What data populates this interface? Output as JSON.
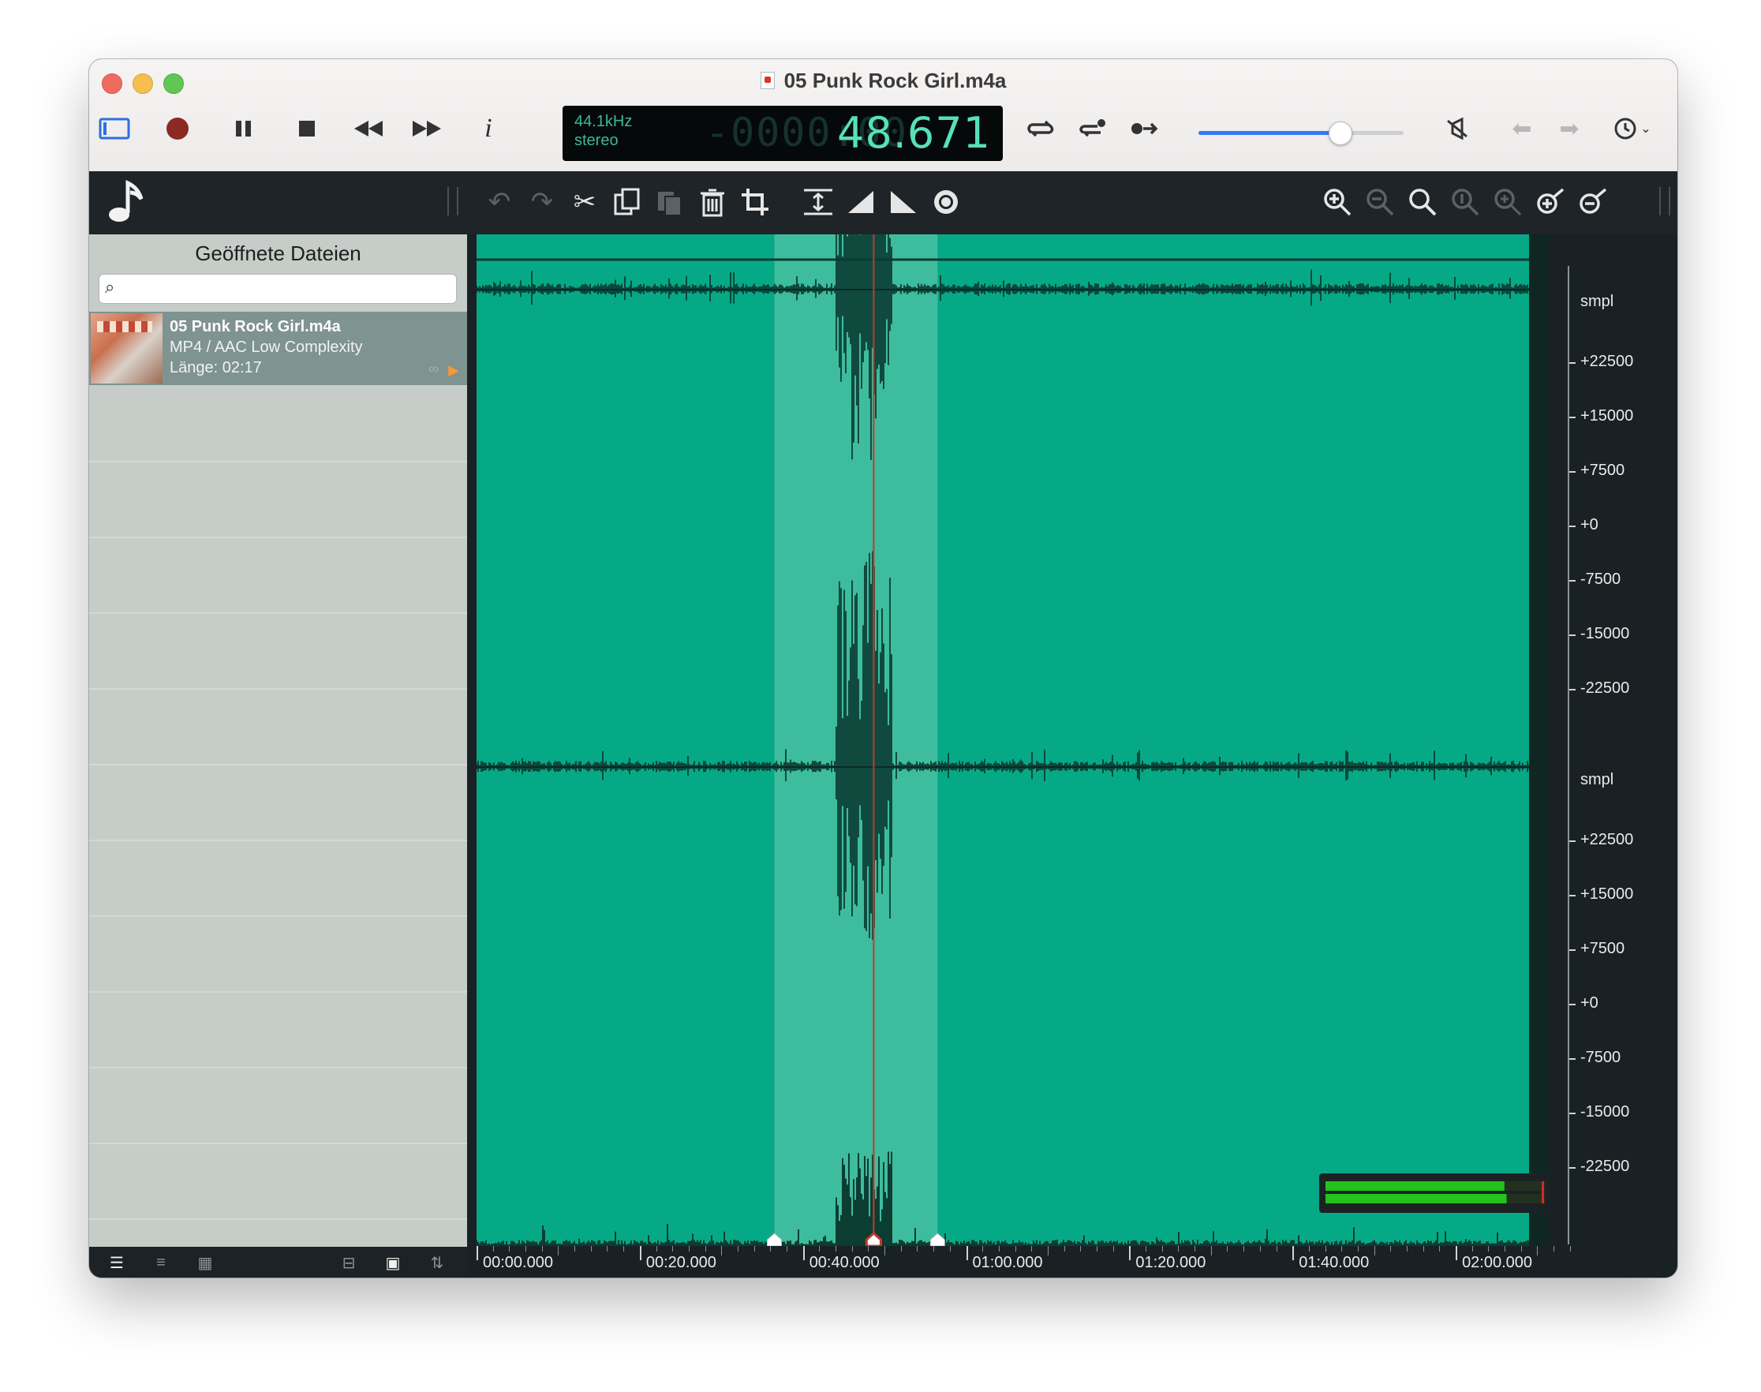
{
  "window": {
    "title": "05 Punk Rock Girl.m4a"
  },
  "transport": {
    "lcd": {
      "samplerate": "44.1kHz",
      "channels": "stereo",
      "ghost": "-0000:00",
      "time": "48.671"
    },
    "volume_fraction": 0.69
  },
  "sidebar": {
    "header": "Geöffnete Dateien",
    "search_placeholder": "",
    "files": [
      {
        "name": "05 Punk Rock Girl.m4a",
        "type": "MP4 / AAC Low Complexity",
        "length": "Länge: 02:17"
      }
    ]
  },
  "waveform": {
    "duration_s": 137,
    "selection_start_s": 36.5,
    "selection_end_s": 56.5,
    "playhead_s": 48.671,
    "time_labels": [
      "00:00.000",
      "00:20.000",
      "00:40.000",
      "01:00.000",
      "01:20.000",
      "01:40.000",
      "02:00.000"
    ],
    "channels": [
      {
        "unit": "smpl",
        "ticks": [
          "+22500",
          "+15000",
          "+7500",
          "+0",
          "-7500",
          "-15000",
          "-22500"
        ]
      },
      {
        "unit": "smpl",
        "ticks": [
          "+22500",
          "+15000",
          "+7500",
          "+0",
          "-7500",
          "-15000",
          "-22500"
        ]
      }
    ]
  },
  "meter": {
    "left_level": 0.84,
    "right_level": 0.85
  },
  "colors": {
    "wave_bg": "#06a986",
    "selection": "#3ebd9e",
    "playhead": "#c43a2e",
    "accent": "#3478f6"
  }
}
